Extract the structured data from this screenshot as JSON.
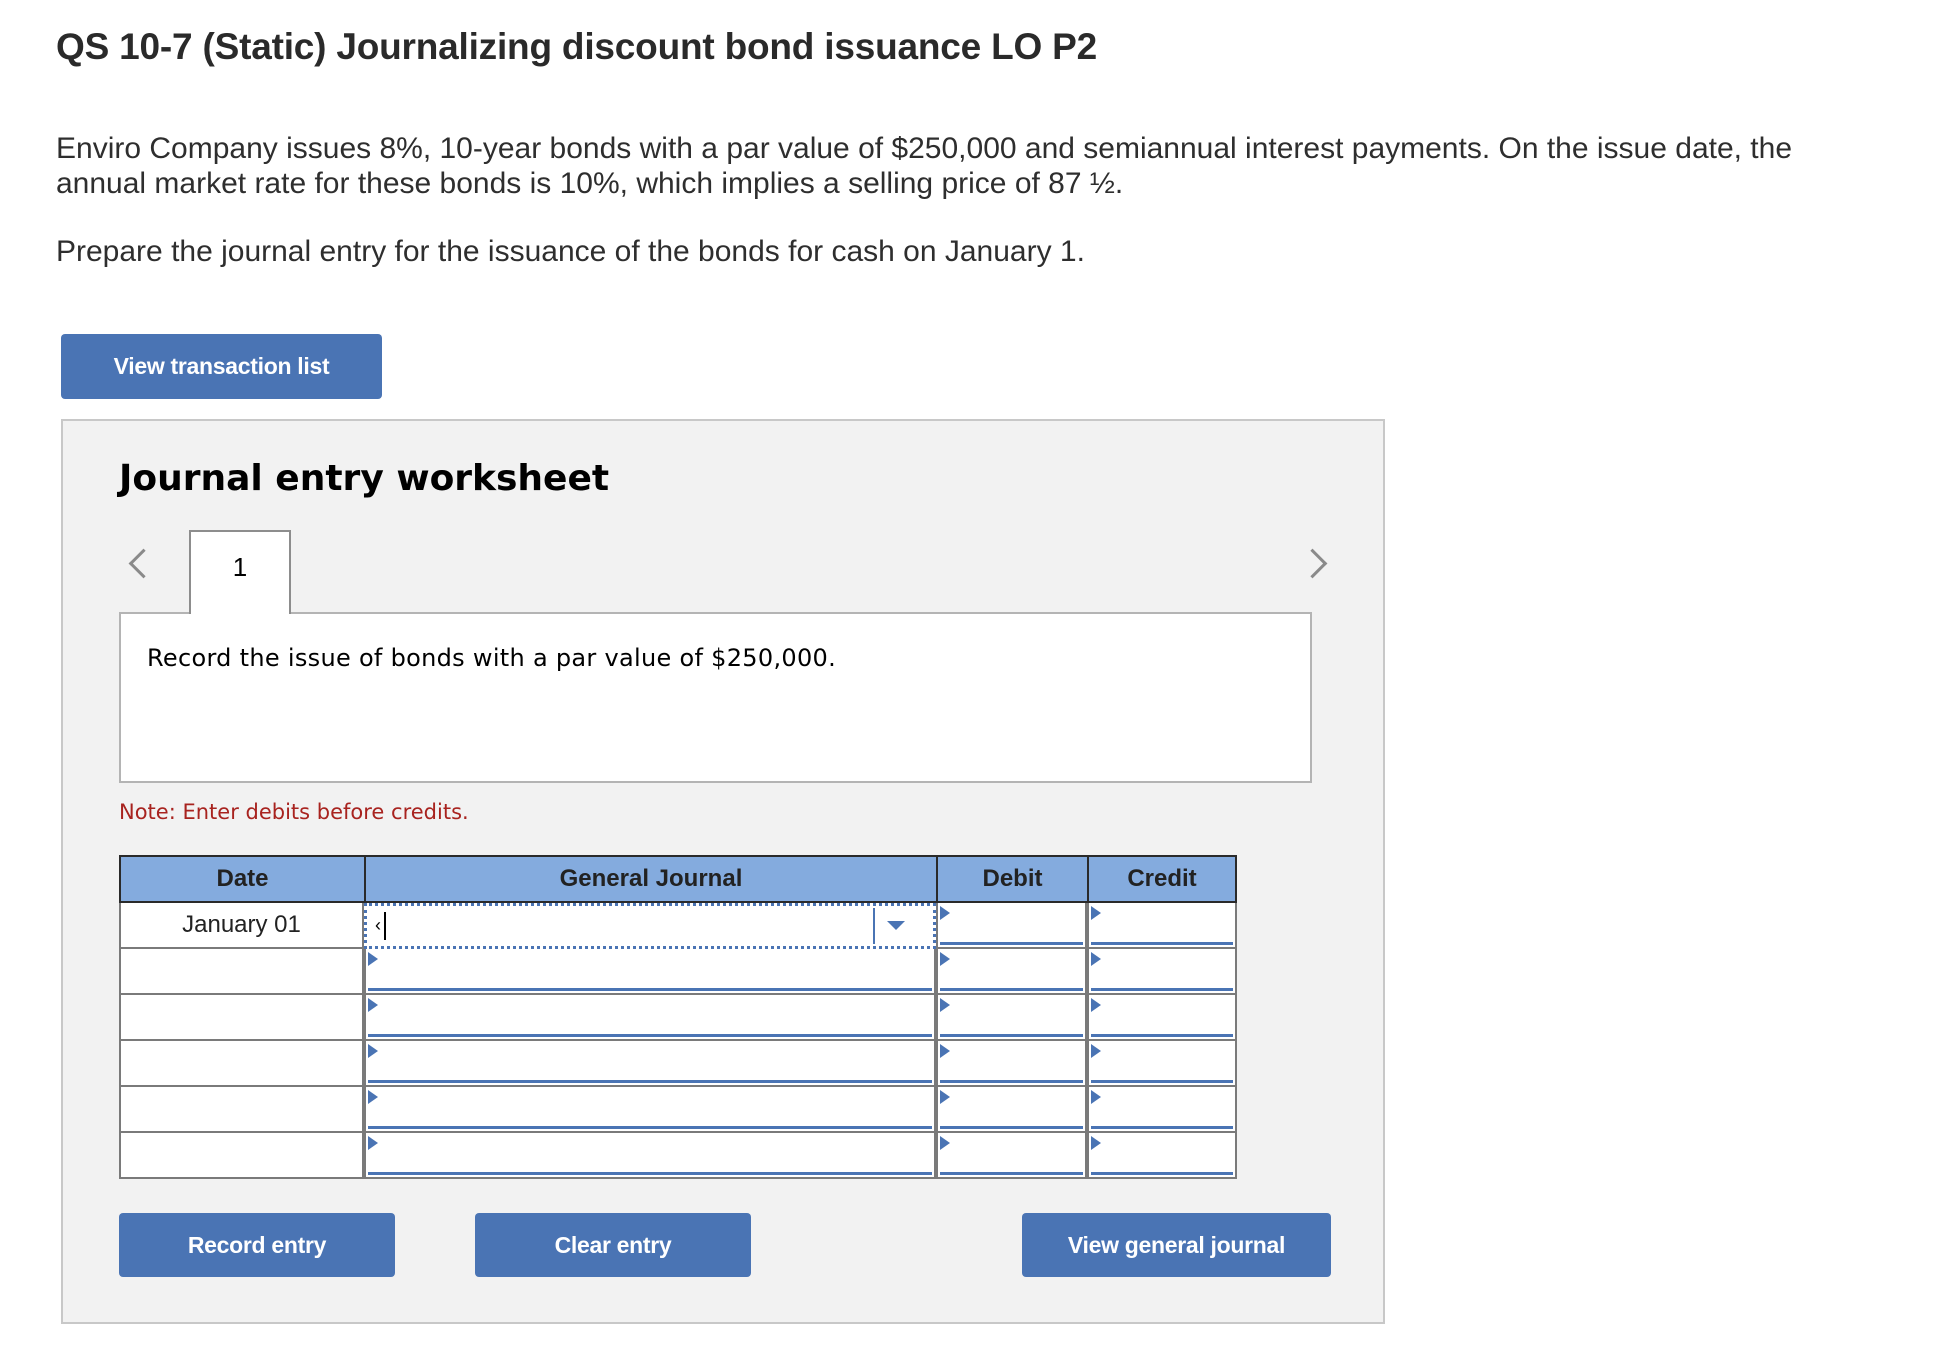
{
  "page": {
    "title": "QS 10-7 (Static) Journalizing discount bond issuance LO P2",
    "paragraphs": [
      "Enviro Company issues 8%, 10-year bonds with a par value of $250,000 and semiannual interest payments. On the issue date, the",
      "annual market rate for these bonds is 10%, which implies a selling price of 87 ½.",
      "Prepare the journal entry for the issuance of the bonds for cash on January 1."
    ],
    "view_transaction_list_label": "View transaction list"
  },
  "worksheet": {
    "heading": "Journal entry worksheet",
    "tabs": [
      {
        "label": "1",
        "active": true
      }
    ],
    "prev_icon": "chevron-left-icon",
    "next_icon": "chevron-right-icon",
    "description": "Record the issue of bonds with a par value of $250,000.",
    "note": "Note: Enter debits before credits.",
    "table": {
      "headers": {
        "date": "Date",
        "journal": "General Journal",
        "debit": "Debit",
        "credit": "Credit"
      },
      "rows": [
        {
          "date": "January 01",
          "account": "‹",
          "debit": "",
          "credit": "",
          "focused": true
        },
        {
          "date": "",
          "account": "",
          "debit": "",
          "credit": ""
        },
        {
          "date": "",
          "account": "",
          "debit": "",
          "credit": ""
        },
        {
          "date": "",
          "account": "",
          "debit": "",
          "credit": ""
        },
        {
          "date": "",
          "account": "",
          "debit": "",
          "credit": ""
        },
        {
          "date": "",
          "account": "",
          "debit": "",
          "credit": ""
        }
      ]
    },
    "buttons": {
      "record": "Record entry",
      "clear": "Clear entry",
      "view_general_journal": "View general journal"
    }
  },
  "colors": {
    "button": "#4a74b4",
    "table_header": "#84abde",
    "note": "#a8231f",
    "panel_bg": "#f2f2f2"
  }
}
